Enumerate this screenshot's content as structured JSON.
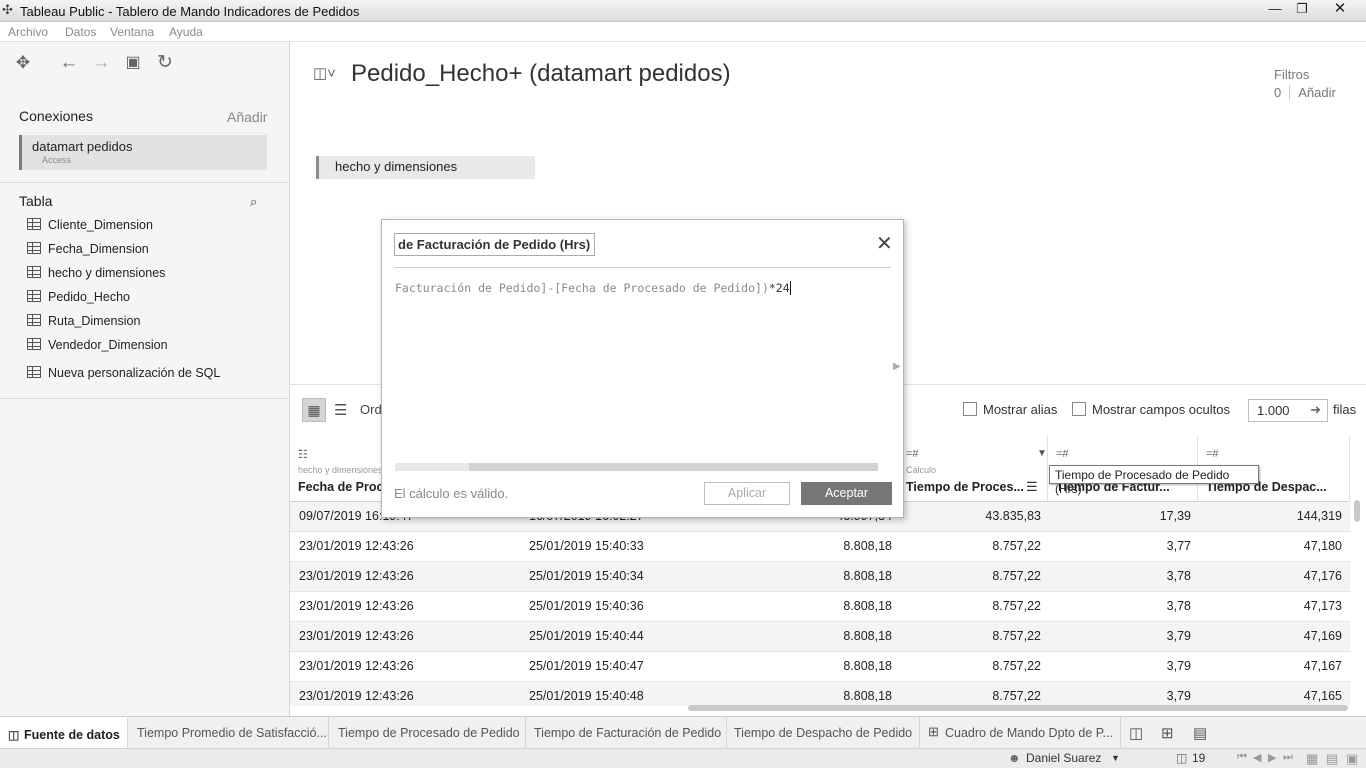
{
  "window": {
    "title": "Tableau Public - Tablero de Mando Indicadores de Pedidos"
  },
  "menu": [
    "Archivo",
    "Datos",
    "Ventana",
    "Ayuda"
  ],
  "sidebar": {
    "connections_header": "Conexiones",
    "connections_add": "Añadir",
    "connection": {
      "name": "datamart pedidos",
      "type": "Access"
    },
    "table_header": "Tabla",
    "tables": [
      "Cliente_Dimension",
      "Fecha_Dimension",
      "hecho y dimensiones",
      "Pedido_Hecho",
      "Ruta_Dimension",
      "Vendedor_Dimension"
    ],
    "custom_sql": "Nueva personalización de SQL"
  },
  "datasource": {
    "title": "Pedido_Hecho+ (datamart pedidos)",
    "filters_label": "Filtros",
    "filters_count": "0",
    "filters_add": "Añadir",
    "canvas_table": "hecho y dimensiones"
  },
  "grid_toolbar": {
    "sort_label": "Ord",
    "show_alias": "Mostrar alias",
    "show_hidden": "Mostrar campos ocultos",
    "rows_value": "1.000",
    "rows_label": "filas"
  },
  "grid": {
    "columns": [
      {
        "source": "hecho y dimensiones",
        "name": "Fecha de Proc"
      },
      {
        "source": "",
        "name": ""
      },
      {
        "source": "",
        "name": ""
      },
      {
        "source": "Cálculo",
        "name": "Tiempo de Proces..."
      },
      {
        "source": "",
        "name": "Tiempo de Factur..."
      },
      {
        "source": "",
        "name": "Tiempo de Despac..."
      }
    ],
    "rows": [
      [
        "09/07/2019 16:19:47",
        "16/07/2019 16:02:27",
        "43.997,34",
        "43.835,83",
        "17,39",
        "144,319"
      ],
      [
        "23/01/2019 12:43:26",
        "25/01/2019 15:40:33",
        "8.808,18",
        "8.757,22",
        "3,77",
        "47,180"
      ],
      [
        "23/01/2019 12:43:26",
        "25/01/2019 15:40:34",
        "8.808,18",
        "8.757,22",
        "3,78",
        "47,176"
      ],
      [
        "23/01/2019 12:43:26",
        "25/01/2019 15:40:36",
        "8.808,18",
        "8.757,22",
        "3,78",
        "47,173"
      ],
      [
        "23/01/2019 12:43:26",
        "25/01/2019 15:40:44",
        "8.808,18",
        "8.757,22",
        "3,79",
        "47,169"
      ],
      [
        "23/01/2019 12:43:26",
        "25/01/2019 15:40:47",
        "8.808,18",
        "8.757,22",
        "3,79",
        "47,167"
      ],
      [
        "23/01/2019 12:43:26",
        "25/01/2019 15:40:48",
        "8.808,18",
        "8.757,22",
        "3,79",
        "47,165"
      ]
    ],
    "tooltip": "Tiempo de Procesado de Pedido (Hrs)"
  },
  "dialog": {
    "calc_name": "de Facturación de Pedido (Hrs)",
    "formula_prefix": "Facturación de Pedido]-[Fecha de Procesado de Pedido])",
    "formula_suffix": "*24",
    "status": "El cálculo es válido.",
    "apply": "Aplicar",
    "ok": "Aceptar"
  },
  "tabs": [
    "Fuente de datos",
    "Tiempo Promedio de Satisfacció...",
    "Tiempo de Procesado de Pedido",
    "Tiempo de Facturación de Pedido",
    "Tiempo de Despacho de Pedido",
    "Cuadro de Mando Dpto de P..."
  ],
  "status": {
    "user": "Daniel Suarez",
    "count": "19"
  }
}
